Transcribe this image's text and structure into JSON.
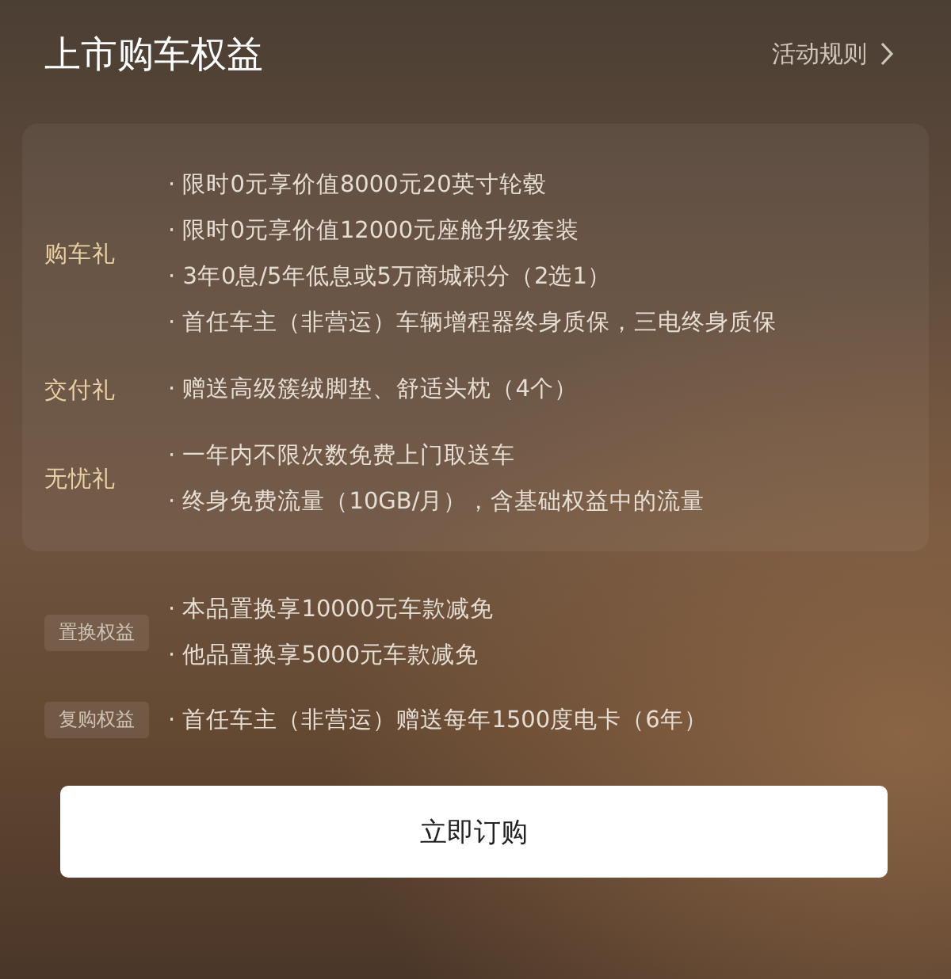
{
  "header": {
    "title": "上市购车权益",
    "rules_link": "活动规则"
  },
  "gift_groups": [
    {
      "label": "购车礼",
      "items": [
        "· 限时0元享价值8000元20英寸轮毂",
        "· 限时0元享价值12000元座舱升级套装",
        "· 3年0息/5年低息或5万商城积分（2选1）",
        "· 首任车主（非营运）车辆增程器终身质保，三电终身质保"
      ]
    },
    {
      "label": "交付礼",
      "items": [
        "· 赠送高级簇绒脚垫、舒适头枕（4个）"
      ]
    },
    {
      "label": "无忧礼",
      "items": [
        "· 一年内不限次数免费上门取送车",
        "· 终身免费流量（10GB/月），含基础权益中的流量"
      ]
    }
  ],
  "tag_groups": [
    {
      "tag": "置换权益",
      "items": [
        "· 本品置换享10000元车款减免",
        "· 他品置换享5000元车款减免"
      ]
    },
    {
      "tag": "复购权益",
      "items": [
        "·  首任车主（非营运）赠送每年1500度电卡（6年）"
      ]
    }
  ],
  "order_button": "立即订购"
}
